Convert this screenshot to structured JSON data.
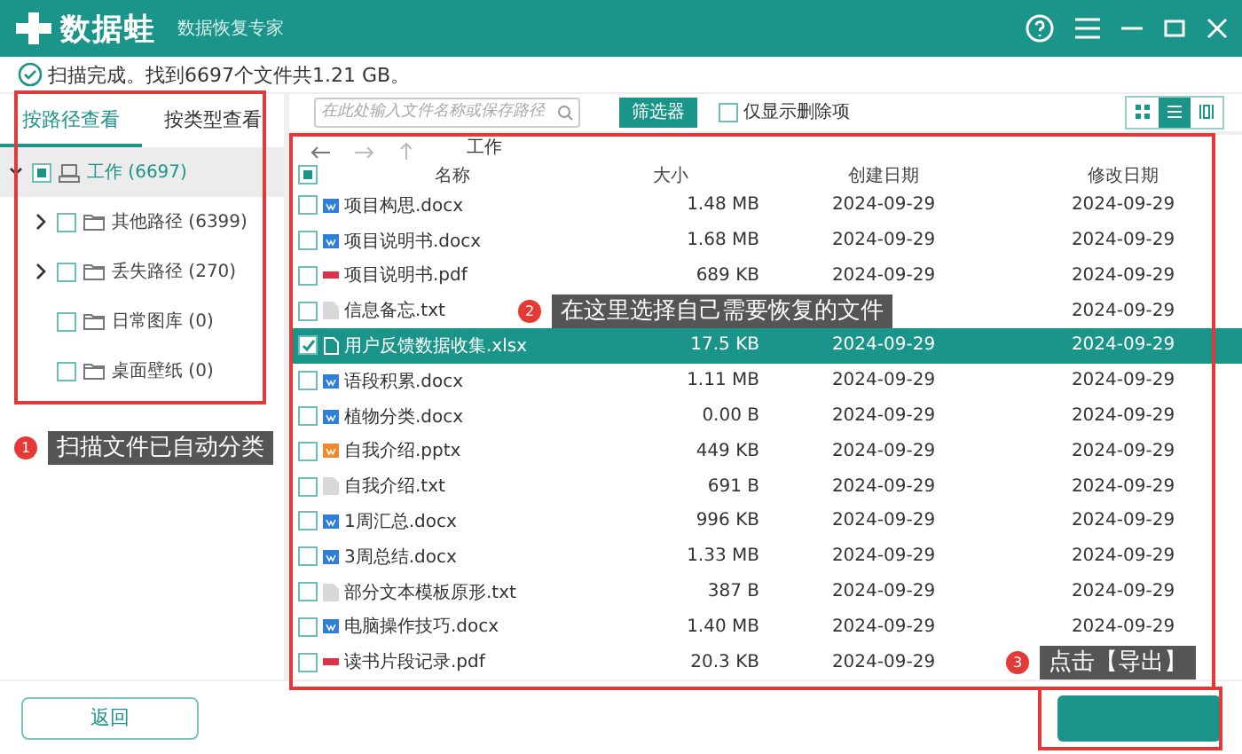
{
  "window": {
    "app_name": "数据蛙",
    "subtitle": "数据恢复专家"
  },
  "scan_status": "扫描完成。找到6697个文件共1.21 GB。",
  "sidebar": {
    "tabs": [
      {
        "label": "按路径查看",
        "selected": true
      },
      {
        "label": "按类型查看",
        "selected": false
      }
    ],
    "tree": [
      {
        "label": "工作 (6697)",
        "partial": true,
        "expanded": true,
        "selected": true,
        "children": [
          {
            "label": "其他路径 (6399)",
            "checked": false,
            "expanded": false,
            "selected": false
          },
          {
            "label": "丢失路径 (270)",
            "checked": false,
            "expanded": false,
            "selected": false
          },
          {
            "label": "日常图库 (0)",
            "checked": false,
            "selected": false
          },
          {
            "label": "桌面壁纸 (0)",
            "checked": false,
            "selected": false
          }
        ]
      }
    ]
  },
  "toolbar": {
    "search": {
      "placeholder": "在此处输入文件名称或保存路径"
    },
    "filter_button": "筛选器",
    "deleted_only": {
      "label": "仅显示删除项",
      "checked": false
    },
    "view_modes": [
      {
        "kind": "grid",
        "selected": false
      },
      {
        "kind": "list",
        "selected": true
      },
      {
        "kind": "detail",
        "selected": false
      }
    ]
  },
  "path": "工作",
  "table": {
    "header_partial": true,
    "columns": [
      "名称",
      "大小",
      "创建日期",
      "修改日期"
    ],
    "rows": [
      {
        "name": "项目构思.docx",
        "kind": "docx",
        "size": "1.48 MB",
        "created": "2024-09-29",
        "modified": "2024-09-29",
        "checked": false,
        "selected": false
      },
      {
        "name": "项目说明书.docx",
        "kind": "docx",
        "size": "1.68 MB",
        "created": "2024-09-29",
        "modified": "2024-09-29",
        "checked": false,
        "selected": false
      },
      {
        "name": "项目说明书.pdf",
        "kind": "pdf",
        "size": "689 KB",
        "created": "2024-09-29",
        "modified": "2024-09-29",
        "checked": false,
        "selected": false
      },
      {
        "name": "信息备忘.txt",
        "kind": "txt",
        "modified": "2024-09-29",
        "checked": false,
        "selected": false
      },
      {
        "name": "用户反馈数据收集.xlsx",
        "kind": "xlsx",
        "size": "17.5 KB",
        "created": "2024-09-29",
        "modified": "2024-09-29",
        "checked": true,
        "selected": true
      },
      {
        "name": "语段积累.docx",
        "kind": "docx",
        "size": "1.11 MB",
        "created": "2024-09-29",
        "modified": "2024-09-29",
        "checked": false,
        "selected": false
      },
      {
        "name": "植物分类.docx",
        "kind": "docx",
        "size": "0.00  B",
        "created": "2024-09-29",
        "modified": "2024-09-29",
        "checked": false,
        "selected": false
      },
      {
        "name": "自我介绍.pptx",
        "kind": "pptx",
        "size": "449 KB",
        "created": "2024-09-29",
        "modified": "2024-09-29",
        "checked": false,
        "selected": false
      },
      {
        "name": "自我介绍.txt",
        "kind": "txt",
        "size": "691  B",
        "created": "2024-09-29",
        "modified": "2024-09-29",
        "checked": false,
        "selected": false
      },
      {
        "name": "1周汇总.docx",
        "kind": "docx",
        "size": "996 KB",
        "created": "2024-09-29",
        "modified": "2024-09-29",
        "checked": false,
        "selected": false
      },
      {
        "name": "3周总结.docx",
        "kind": "docx",
        "size": "1.33 MB",
        "created": "2024-09-29",
        "modified": "2024-09-29",
        "checked": false,
        "selected": false
      },
      {
        "name": "部分文本模板原形.txt",
        "kind": "txt",
        "size": "387  B",
        "created": "2024-09-29",
        "modified": "2024-09-29",
        "checked": false,
        "selected": false
      },
      {
        "name": "电脑操作技巧.docx",
        "kind": "docx",
        "size": "1.40 MB",
        "created": "2024-09-29",
        "modified": "2024-09-29",
        "checked": false,
        "selected": false
      },
      {
        "name": "读书片段记录.pdf",
        "kind": "pdf",
        "size": "20.3 KB",
        "created": "2024-09-29",
        "checked": false,
        "selected": false
      }
    ]
  },
  "back_button": "返回",
  "annotations": [
    {
      "number": "1",
      "text": "扫描文件已自动分类"
    },
    {
      "number": "2",
      "text": "在这里选择自己需要恢复的文件"
    },
    {
      "number": "3",
      "text": "点击【导出】"
    }
  ]
}
